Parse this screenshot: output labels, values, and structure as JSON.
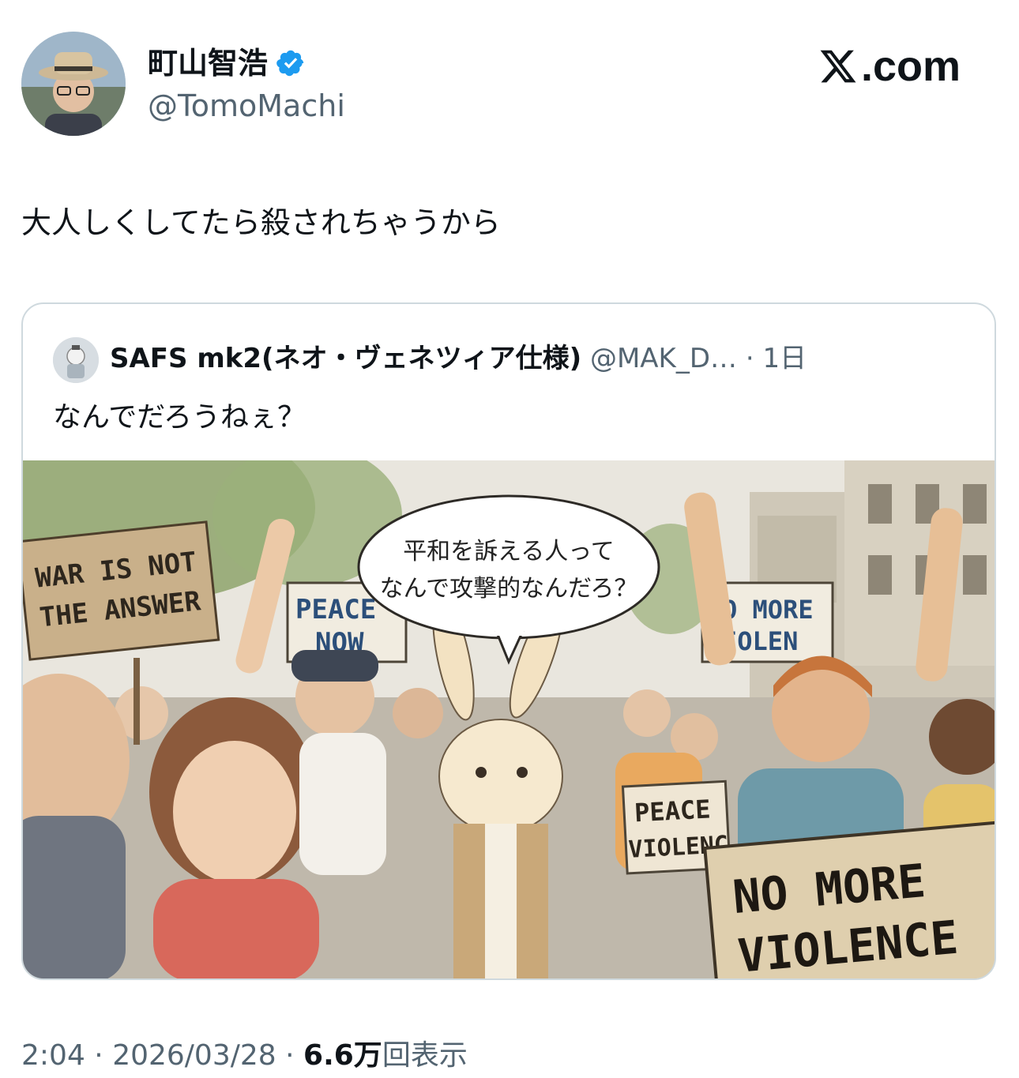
{
  "author": {
    "name": "町山智浩",
    "handle": "@TomoMachi"
  },
  "brand": {
    "site": ".com"
  },
  "tweet": {
    "text": "大人しくしてたら殺されちゃうから"
  },
  "quote": {
    "name": "SAFS mk2(ネオ・ヴェネツィア仕様)",
    "handle": "@MAK_D…",
    "separator": "·",
    "time": "1日",
    "text": "なんでだろうねぇ？",
    "image": {
      "speech_bubble_line1": "平和を訴える人って",
      "speech_bubble_line2": "なんで攻撃的なんだろ？",
      "sign_war_line1": "WAR IS NOT",
      "sign_war_line2": "THE ANSWER",
      "sign_peace_now_line1": "PEACE",
      "sign_peace_now_line2": "NOW",
      "sign_no_more_top_line1": "O MORE",
      "sign_no_more_top_line2": "IOLEN",
      "sign_peace_small_line1": "PEACE",
      "sign_peace_small_line2": "VIOLENC",
      "sign_big_line1": "NO MORE",
      "sign_big_line2": "VIOLENCE"
    }
  },
  "footer": {
    "time": "2:04",
    "sep1": " · ",
    "date": "2026/03/28",
    "sep2": " · ",
    "views_count": "6.6万",
    "views_label": "回表示"
  },
  "colors": {
    "verified": "#1d9bf0",
    "text_primary": "#0f1419",
    "text_secondary": "#536471",
    "border": "#cfd9de"
  }
}
